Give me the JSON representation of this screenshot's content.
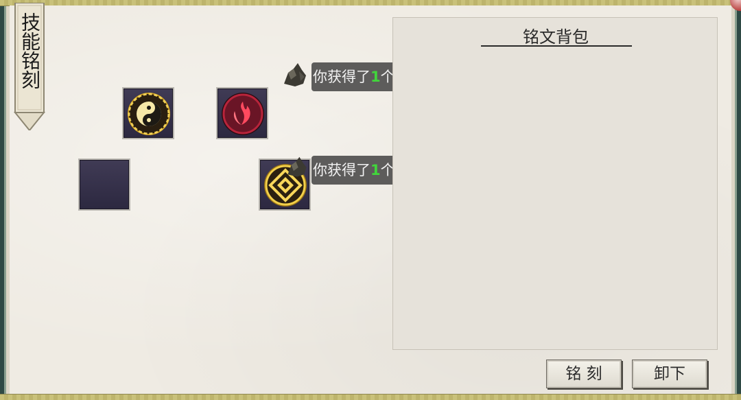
{
  "panel": {
    "tab_label": "技能铭刻"
  },
  "inscription_bag": {
    "title": "铭文背包"
  },
  "notifications": [
    {
      "prefix": "你获得了",
      "qty": "1",
      "suffix": "个[矿渣]"
    },
    {
      "prefix": "你获得了",
      "qty": "1",
      "suffix": "个[矿渣]"
    }
  ],
  "slots": [
    {
      "icon": "yin-yang-emblem"
    },
    {
      "icon": "red-flame-emblem"
    },
    {
      "icon": "empty"
    },
    {
      "icon": "gold-diamond-emblem"
    }
  ],
  "buttons": {
    "inscribe": "铭 刻",
    "unequip": "卸下"
  },
  "colors": {
    "qty_green": "#41d63b",
    "slot_bg": "#35314a",
    "paper": "#efebe3"
  }
}
